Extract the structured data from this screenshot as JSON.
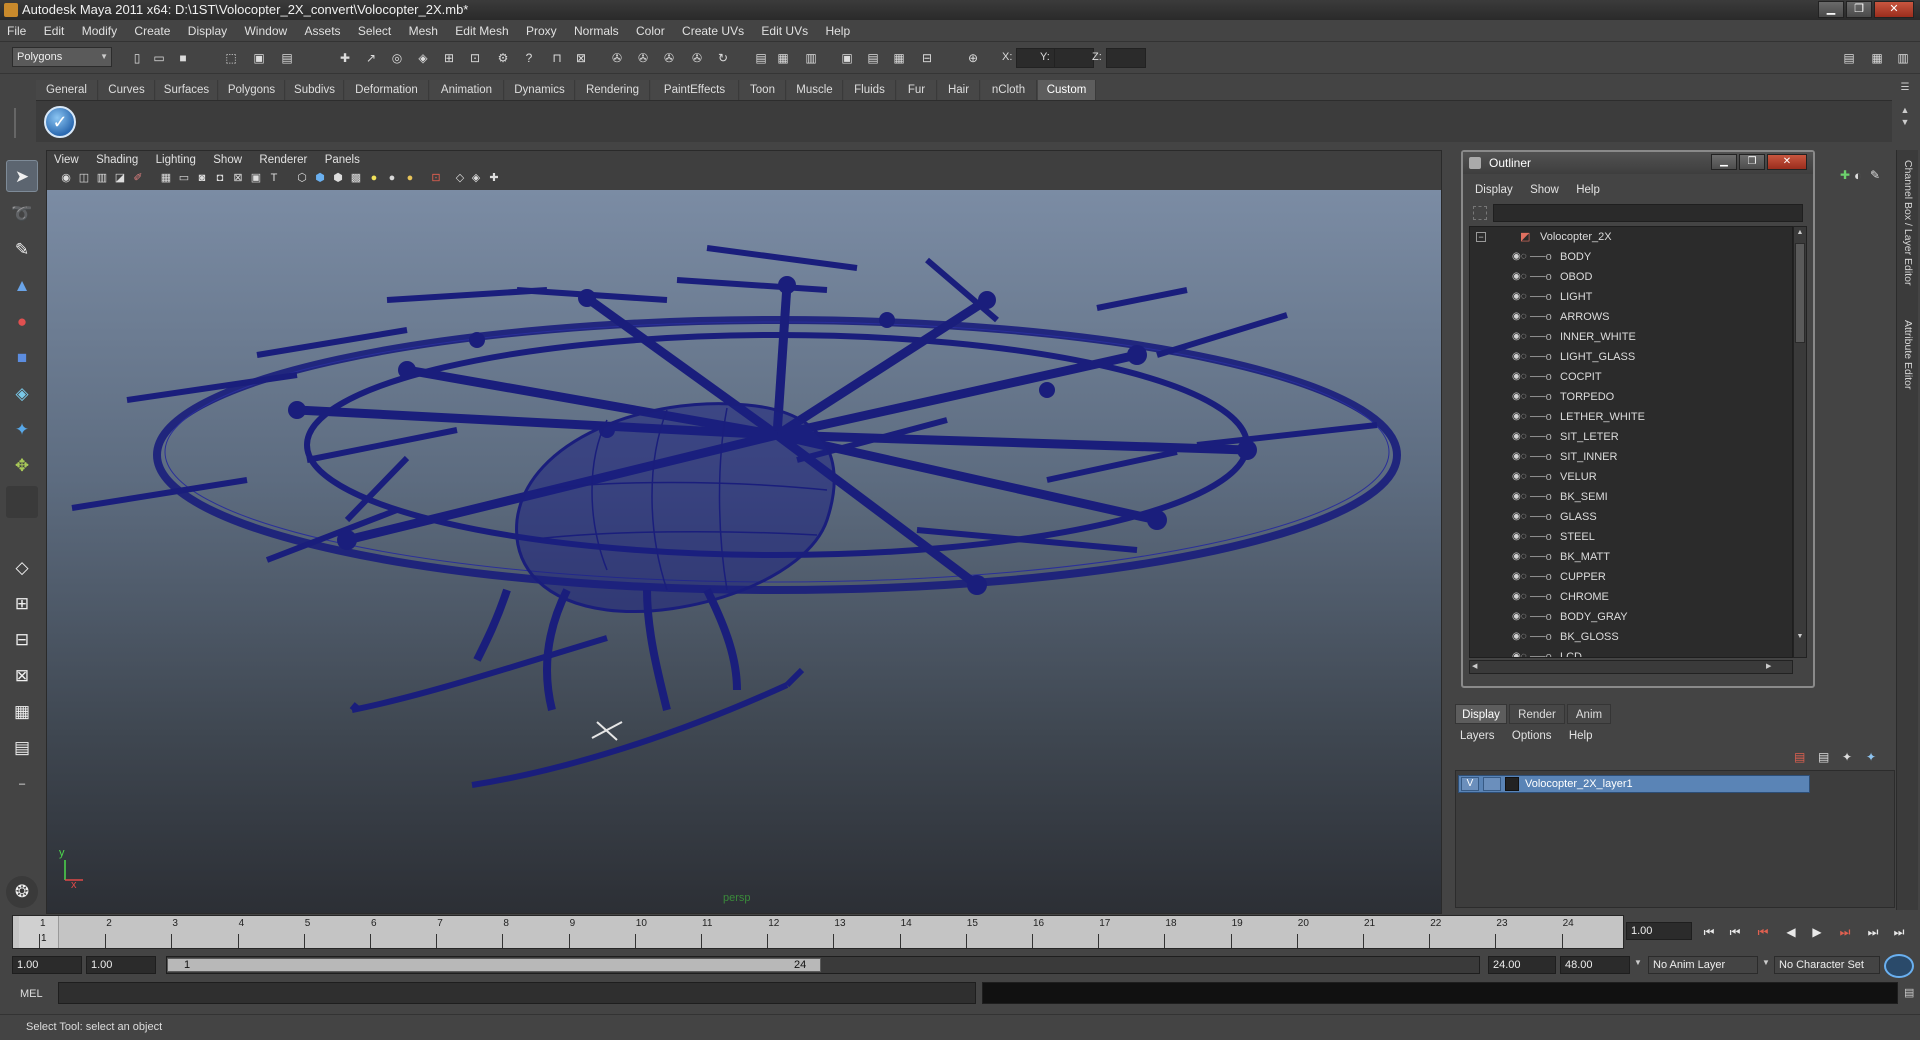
{
  "window": {
    "title": "Autodesk Maya 2011 x64: D:\\1ST\\Volocopter_2X_convert\\Volocopter_2X.mb*",
    "minimize": "▁",
    "maximize": "❐",
    "close": "✕"
  },
  "menubar": [
    "File",
    "Edit",
    "Modify",
    "Create",
    "Display",
    "Window",
    "Assets",
    "Select",
    "Mesh",
    "Edit Mesh",
    "Proxy",
    "Normals",
    "Color",
    "Create UVs",
    "Edit UVs",
    "Help"
  ],
  "statusline": {
    "mode": "Polygons",
    "x_label": "X:",
    "y_label": "Y:",
    "z_label": "Z:"
  },
  "shelf": {
    "tabs": [
      "General",
      "Curves",
      "Surfaces",
      "Polygons",
      "Subdivs",
      "Deformation",
      "Animation",
      "Dynamics",
      "Rendering",
      "PaintEffects",
      "Toon",
      "Muscle",
      "Fluids",
      "Fur",
      "Hair",
      "nCloth",
      "Custom"
    ],
    "active_tab": "Custom",
    "custom_button_icon": "checkmark-icon"
  },
  "viewport": {
    "menu": [
      "View",
      "Shading",
      "Lighting",
      "Show",
      "Renderer",
      "Panels"
    ],
    "camera": "persp",
    "axis_y": "y",
    "axis_x": "x",
    "wireframe_color": "#1a1e7c"
  },
  "outliner": {
    "title": "Outliner",
    "menu": [
      "Display",
      "Show",
      "Help"
    ],
    "root": "Volocopter_2X",
    "items": [
      "BODY",
      "OBOD",
      "LIGHT",
      "ARROWS",
      "INNER_WHITE",
      "LIGHT_GLASS",
      "COCPIT",
      "TORPEDO",
      "LETHER_WHITE",
      "SIT_LETER",
      "SIT_INNER",
      "VELUR",
      "BK_SEMI",
      "GLASS",
      "STEEL",
      "BK_MATT",
      "CUPPER",
      "CHROME",
      "BODY_GRAY",
      "BK_GLOSS",
      "LCD"
    ]
  },
  "layer_editor": {
    "tabs": [
      "Display",
      "Render",
      "Anim"
    ],
    "active_tab": "Display",
    "menu": [
      "Layers",
      "Options",
      "Help"
    ],
    "layer_visible": "V",
    "layer_name": "Volocopter_2X_layer1",
    "layer_color": "#5a84b6"
  },
  "side_tabs": [
    "Channel Box / Layer Editor",
    "Attribute Editor"
  ],
  "timeline": {
    "ticks": [
      "1",
      "2",
      "3",
      "4",
      "5",
      "6",
      "7",
      "8",
      "9",
      "10",
      "11",
      "12",
      "13",
      "14",
      "15",
      "16",
      "17",
      "18",
      "19",
      "20",
      "21",
      "22",
      "23",
      "24"
    ],
    "current_frame": "1",
    "current_time": "1.00",
    "start_time": "1.00",
    "playback_start": "1.00",
    "range_start": "1",
    "range_end": "24",
    "playback_end": "24.00",
    "end_time": "48.00",
    "anim_layer": "No Anim Layer",
    "character_set": "No Character Set"
  },
  "command_line": {
    "label": "MEL",
    "help_line": "Select Tool: select an object"
  }
}
